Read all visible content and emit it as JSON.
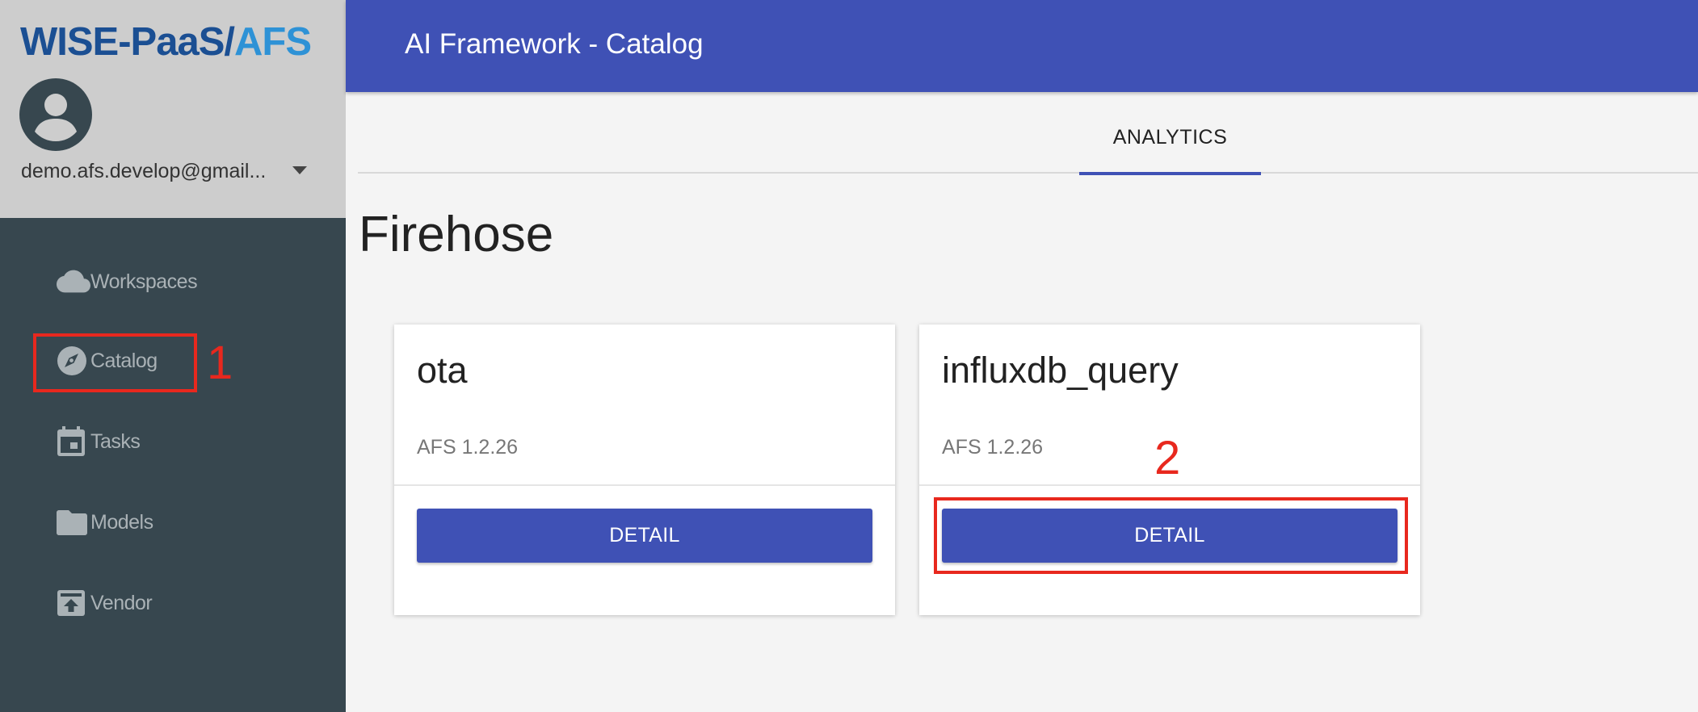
{
  "app": {
    "logo_part1": "WISE-PaaS/",
    "logo_part2": "AFS",
    "title": "AI Framework - Catalog"
  },
  "user": {
    "email": "demo.afs.develop@gmail..."
  },
  "sidebar": {
    "items": [
      {
        "label": "Workspaces",
        "icon": "cloud-icon"
      },
      {
        "label": "Catalog",
        "icon": "compass-icon"
      },
      {
        "label": "Tasks",
        "icon": "calendar-icon"
      },
      {
        "label": "Models",
        "icon": "folder-icon"
      },
      {
        "label": "Vendor",
        "icon": "archive-upload-icon"
      }
    ]
  },
  "tabs": [
    {
      "label": "ANALYTICS",
      "active": true
    }
  ],
  "section": {
    "title": "Firehose"
  },
  "cards": [
    {
      "title": "ota",
      "version": "AFS 1.2.26",
      "button": "DETAIL"
    },
    {
      "title": "influxdb_query",
      "version": "AFS 1.2.26",
      "button": "DETAIL"
    }
  ],
  "annotations": {
    "step1": "1",
    "step2": "2",
    "color": "#e8281e"
  },
  "colors": {
    "primary": "#3f51b5",
    "sidebar": "#37474f",
    "profile_bg": "#cdcdcd",
    "logo_dark": "#1b4f93",
    "logo_light": "#2e92d6"
  }
}
